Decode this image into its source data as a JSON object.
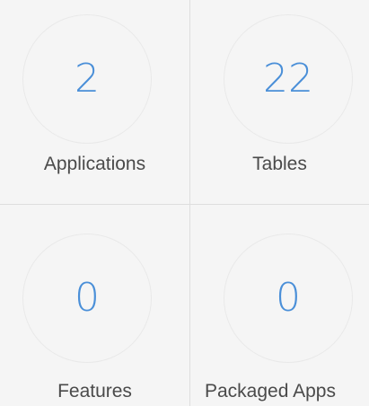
{
  "tiles": {
    "applications": {
      "count": "2",
      "label": "Applications"
    },
    "tables": {
      "count": "22",
      "label": "Tables"
    },
    "features": {
      "count": "0",
      "label": "Features"
    },
    "packaged_apps": {
      "count": "0",
      "label": "Packaged Apps"
    }
  },
  "colors": {
    "count": "#4a8fd8",
    "label": "#4a4a4a",
    "background": "#f5f5f5",
    "divider": "#dedede"
  }
}
